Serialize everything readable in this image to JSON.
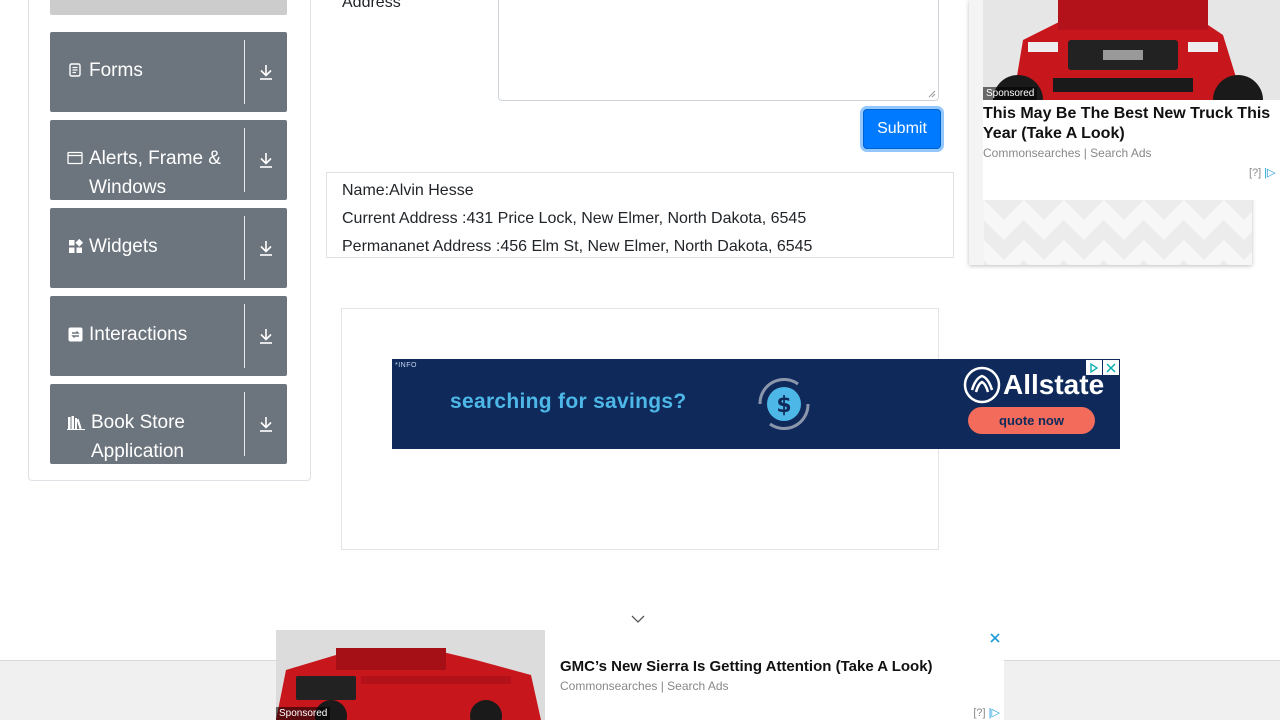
{
  "sidebar": {
    "groups": [
      {
        "label": "Forms",
        "icon": "form-icon"
      },
      {
        "label": "Alerts, Frame & Windows",
        "icon": "window-icon"
      },
      {
        "label": "Widgets",
        "icon": "widgets-icon"
      },
      {
        "label": "Interactions",
        "icon": "interactions-icon"
      },
      {
        "label": "Book Store Application",
        "icon": "books-icon"
      }
    ]
  },
  "form": {
    "address_label": "Address",
    "submit_label": "Submit"
  },
  "output": {
    "name": "Name:Alvin Hesse",
    "current_address": "Current Address :431 Price Lock, New Elmer, North Dakota, 6545",
    "permanent_address": "Permananet Address :456 Elm St, New Elmer, North Dakota, 6545"
  },
  "ads": {
    "banner": {
      "info": "*INFO",
      "tagline": "searching for savings?",
      "brand": "Allstate",
      "cta": "quote now"
    },
    "right": {
      "sponsored": "Sponsored",
      "headline": "This May Be The Best New Truck This Year (Take A Look)",
      "source": "Commonsearches | Search Ads",
      "help": "[?]"
    },
    "bottom": {
      "sponsored": "Sponsored",
      "headline": "GMC’s New Sierra Is Getting Attention (Take A Look)",
      "source": "Commonsearches | Search Ads",
      "help": "[?]"
    }
  },
  "colors": {
    "group_bg": "#6c757d",
    "submit": "#007bff",
    "banner_bg": "#0f2a5a",
    "banner_accent": "#4db8e8",
    "cta": "#f26b5b"
  }
}
